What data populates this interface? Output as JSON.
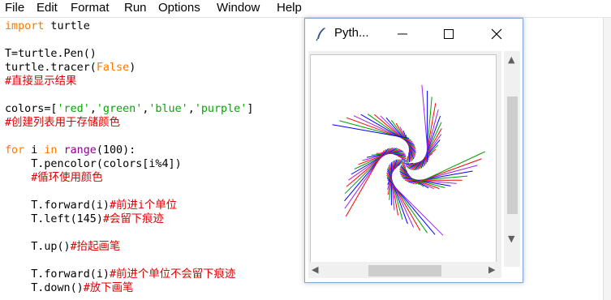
{
  "menu": [
    "File",
    "Edit",
    "Format",
    "Run",
    "Options",
    "Window",
    "Help"
  ],
  "code": [
    [
      {
        "t": "import",
        "c": "kw"
      },
      {
        "t": " turtle",
        "c": ""
      }
    ],
    [],
    [
      {
        "t": "T=turtle.Pen()",
        "c": ""
      }
    ],
    [
      {
        "t": "turtle.tracer(",
        "c": ""
      },
      {
        "t": "False",
        "c": "kw"
      },
      {
        "t": ")",
        "c": ""
      }
    ],
    [
      {
        "t": "#直接显示结果",
        "c": "cmt"
      }
    ],
    [],
    [
      {
        "t": "colors=[",
        "c": ""
      },
      {
        "t": "'red'",
        "c": "str"
      },
      {
        "t": ",",
        "c": ""
      },
      {
        "t": "'green'",
        "c": "str"
      },
      {
        "t": ",",
        "c": ""
      },
      {
        "t": "'blue'",
        "c": "str"
      },
      {
        "t": ",",
        "c": ""
      },
      {
        "t": "'purple'",
        "c": "str"
      },
      {
        "t": "]",
        "c": ""
      }
    ],
    [
      {
        "t": "#创建列表用于存储颜色",
        "c": "cmt"
      }
    ],
    [],
    [
      {
        "t": "for",
        "c": "kw"
      },
      {
        "t": " i ",
        "c": ""
      },
      {
        "t": "in",
        "c": "kw"
      },
      {
        "t": " ",
        "c": ""
      },
      {
        "t": "range",
        "c": "bi"
      },
      {
        "t": "(100):",
        "c": ""
      }
    ],
    [
      {
        "t": "    T.pencolor(colors[i%4])",
        "c": ""
      }
    ],
    [
      {
        "t": "    ",
        "c": ""
      },
      {
        "t": "#循环使用颜色",
        "c": "cmt"
      }
    ],
    [],
    [
      {
        "t": "    T.forward(i)",
        "c": ""
      },
      {
        "t": "#前进i个单位",
        "c": "cmt"
      }
    ],
    [
      {
        "t": "    T.left(145)",
        "c": ""
      },
      {
        "t": "#会留下痕迹",
        "c": "cmt"
      }
    ],
    [],
    [
      {
        "t": "    T.up()",
        "c": ""
      },
      {
        "t": "#抬起画笔",
        "c": "cmt"
      }
    ],
    [],
    [
      {
        "t": "    T.forward(i)",
        "c": ""
      },
      {
        "t": "#前进个单位不会留下痕迹",
        "c": "cmt"
      }
    ],
    [
      {
        "t": "    T.down()",
        "c": ""
      },
      {
        "t": "#放下画笔",
        "c": "cmt"
      }
    ]
  ],
  "turtle_window": {
    "title": "Pyth...",
    "pen_colors": [
      "#ff0000",
      "#00a000",
      "#0000ff",
      "#a020f0"
    ],
    "steps": 100,
    "turn_degrees": 145
  }
}
